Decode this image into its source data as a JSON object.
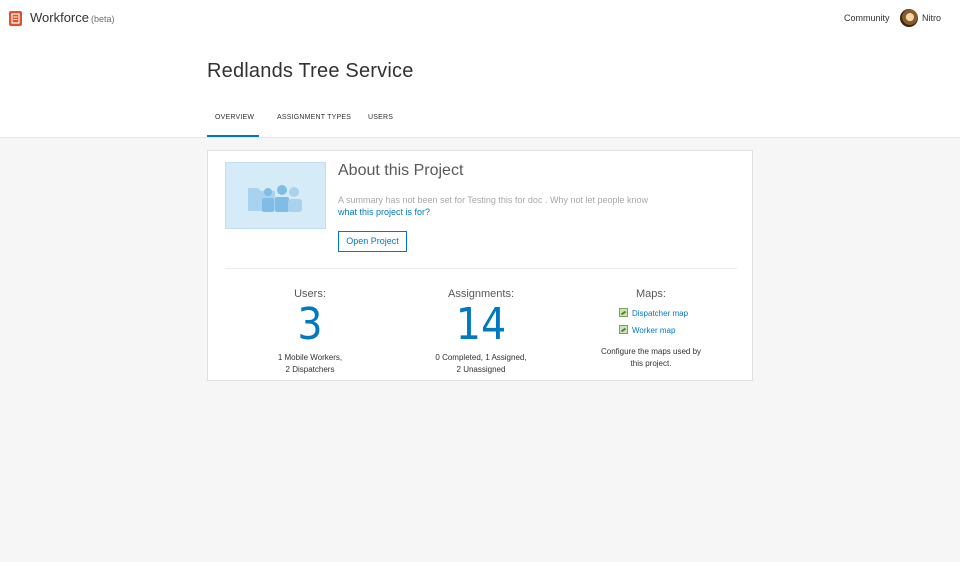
{
  "app": {
    "title": "Workforce",
    "beta": "(beta)",
    "community_label": "Community",
    "user_name": "Nitro",
    "brand_color": "#e0542a",
    "accent_color": "#0079c1"
  },
  "page": {
    "title": "Redlands Tree Service"
  },
  "tabs": [
    {
      "label": "OVERVIEW",
      "active": true
    },
    {
      "label": "ASSIGNMENT TYPES",
      "active": false
    },
    {
      "label": "USERS",
      "active": false
    }
  ],
  "about": {
    "title": "About this Project",
    "summary": "A summary has not been set for Testing this for doc . Why not let people know",
    "summary_link": "what this project is for?",
    "open_button": "Open Project"
  },
  "stats": {
    "users": {
      "label": "Users:",
      "value": "3",
      "desc_line1": "1 Mobile Workers,",
      "desc_line2": "2 Dispatchers"
    },
    "assignments": {
      "label": "Assignments:",
      "value": "14",
      "desc_line1": "0 Completed, 1 Assigned,",
      "desc_line2": "2 Unassigned"
    },
    "maps": {
      "label": "Maps:",
      "items": [
        "Dispatcher map",
        "Worker map"
      ],
      "desc_line1": "Configure the maps used by",
      "desc_line2": "this project."
    }
  }
}
